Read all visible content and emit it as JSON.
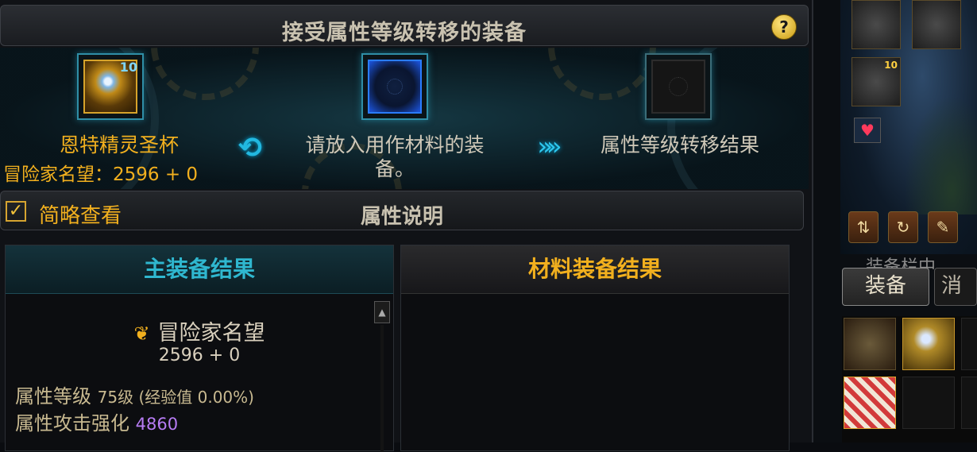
{
  "window": {
    "title": "接受属性等级转移的装备",
    "help_label": "?"
  },
  "transfer": {
    "main_item_name": "恩特精灵圣杯",
    "main_item_badge": "10",
    "renown_line": "冒险家名望：2596 + 0",
    "material_hint": "请放入用作材料的装备。",
    "result_label": "属性等级转移结果"
  },
  "subbar": {
    "brief_view_label": "简略查看",
    "brief_view_checked": true,
    "section_title": "属性说明"
  },
  "main_result": {
    "header": "主装备结果",
    "renown_title": "冒险家名望",
    "renown_value": "2596 + 0",
    "stat_level_label": "属性等级",
    "stat_level_value": "75级 (经验值 0.00%)",
    "stat_attack_label": "属性攻击强化",
    "stat_attack_value": "4860"
  },
  "material_result": {
    "header": "材料装备结果"
  },
  "side": {
    "equip_slot_badge": "10",
    "notice_text": "装备栏中",
    "tabs": [
      "装备",
      "消耗"
    ]
  },
  "colors": {
    "accent_gold": "#f2b01e",
    "accent_cyan": "#2fb7cf",
    "purple_value": "#b77cf4"
  }
}
